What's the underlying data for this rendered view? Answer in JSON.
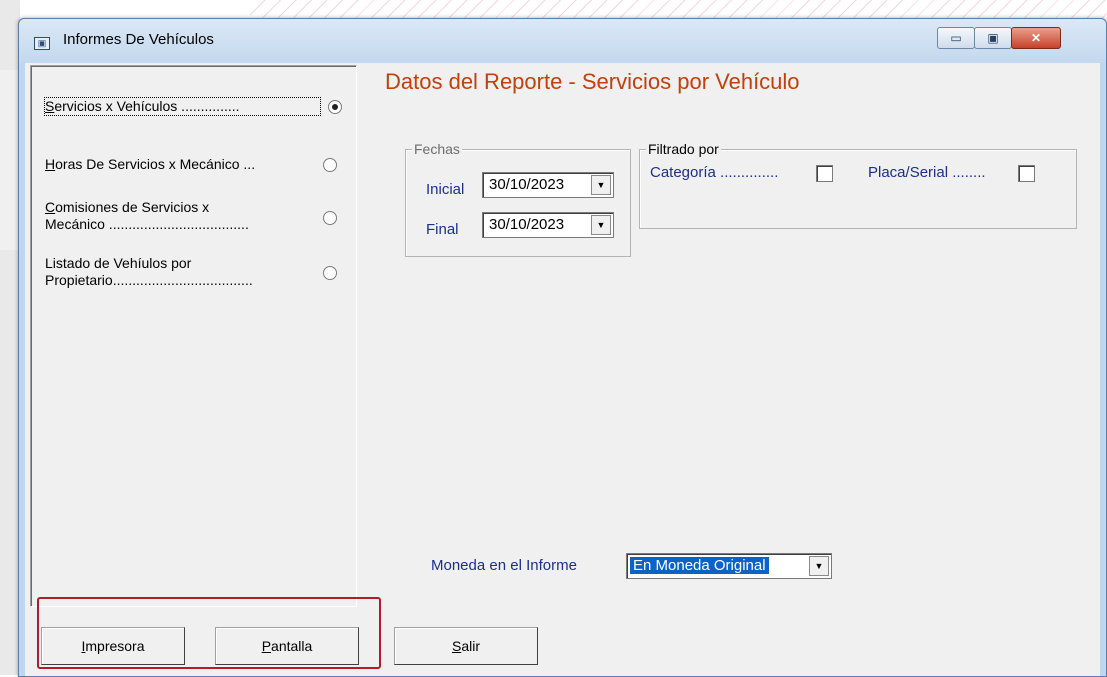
{
  "window": {
    "title": "Informes De Vehículos",
    "min_glyph": "▭",
    "max_glyph": "▣",
    "close_glyph": "✕"
  },
  "report_options": [
    {
      "prefix": "S",
      "text": "ervicios x Vehículos ...............",
      "line2": "",
      "checked": true
    },
    {
      "prefix": "H",
      "text": "oras De Servicios x Mecánico ...",
      "line2": "",
      "checked": false
    },
    {
      "prefix": "C",
      "text": "omisiones de Servicios x",
      "line2": "Mecánico ....................................",
      "checked": false
    },
    {
      "prefix": "",
      "text": "Listado de Vehíulos por",
      "line2": "Propietario....................................",
      "checked": false
    }
  ],
  "report_title": "Datos del Reporte - Servicios por Vehículo",
  "dates": {
    "legend": "Fechas",
    "initial_label": "Inicial",
    "initial_value": "30/10/2023",
    "final_label": "Final",
    "final_value": "30/10/2023"
  },
  "filter": {
    "legend": "Filtrado por",
    "category_label": "Categoría ..............",
    "plate_label": "Placa/Serial ........"
  },
  "currency": {
    "label": "Moneda en el Informe",
    "value": "En Moneda Original"
  },
  "buttons": {
    "printer_u": "I",
    "printer_rest": "mpresora",
    "screen_u": "P",
    "screen_rest": "antalla",
    "exit_u": "S",
    "exit_rest": "alir"
  },
  "colors": {
    "title_accent": "#c0410b",
    "label_blue": "#1b2f8c",
    "highlight": "#b31b2b",
    "selection": "#0a64c8"
  },
  "icons": {
    "dropdown": "▼"
  }
}
